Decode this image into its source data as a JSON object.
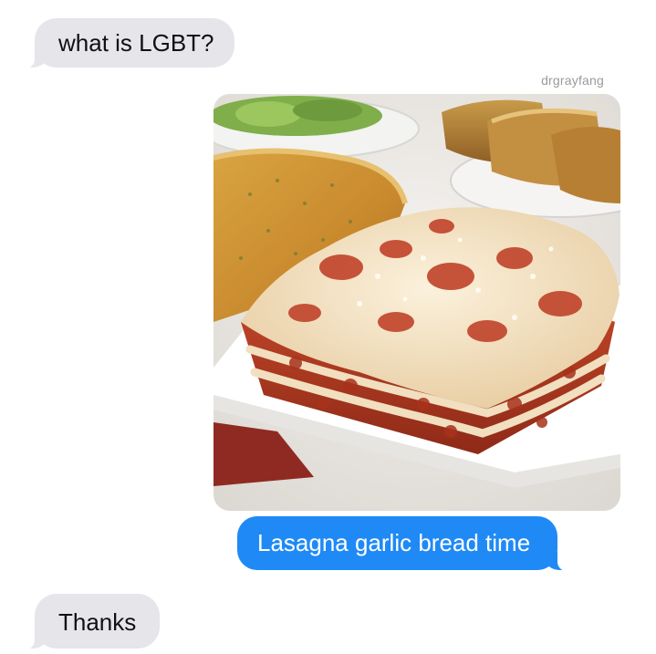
{
  "conversation": {
    "messages": [
      {
        "direction": "incoming",
        "type": "text",
        "text": "what is LGBT?"
      },
      {
        "direction": "outgoing",
        "type": "image",
        "image_description": "lasagna-with-garlic-bread"
      },
      {
        "direction": "outgoing",
        "type": "text",
        "text": "Lasagna garlic bread time"
      },
      {
        "direction": "incoming",
        "type": "text",
        "text": "Thanks"
      }
    ]
  },
  "watermark": "drgrayfang",
  "colors": {
    "incoming_bubble": "#e5e5ea",
    "outgoing_bubble": "#1f8af5",
    "background": "#ffffff"
  }
}
